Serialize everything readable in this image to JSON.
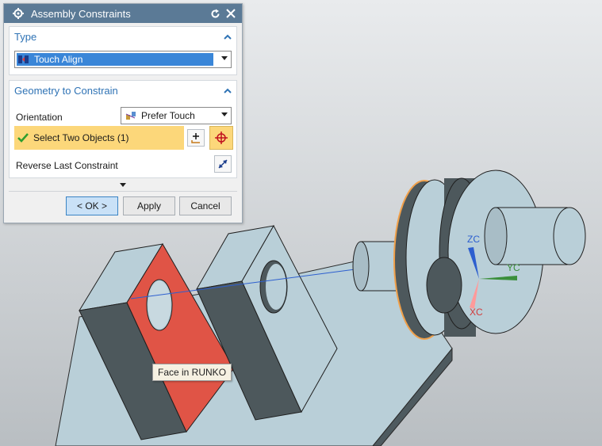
{
  "dialog": {
    "title": "Assembly Constraints",
    "type_group": {
      "label": "Type",
      "selected": "Touch Align"
    },
    "geometry_group": {
      "label": "Geometry to Constrain",
      "orientation_label": "Orientation",
      "orientation_value": "Prefer Touch",
      "select_label": "Select Two Objects (1)",
      "reverse_label": "Reverse Last Constraint"
    },
    "buttons": {
      "ok": "< OK >",
      "apply": "Apply",
      "cancel": "Cancel"
    }
  },
  "viewport": {
    "tooltip": "Face in RUNKO",
    "axes": {
      "x": "XC",
      "y": "YC",
      "z": "ZC"
    }
  },
  "colors": {
    "titlebar": "#5b7a96",
    "group_header": "#2f73b5",
    "selection_highlight": "#fcd77a",
    "selected_face": "#e05446",
    "highlight_edge": "#f0a04a"
  }
}
